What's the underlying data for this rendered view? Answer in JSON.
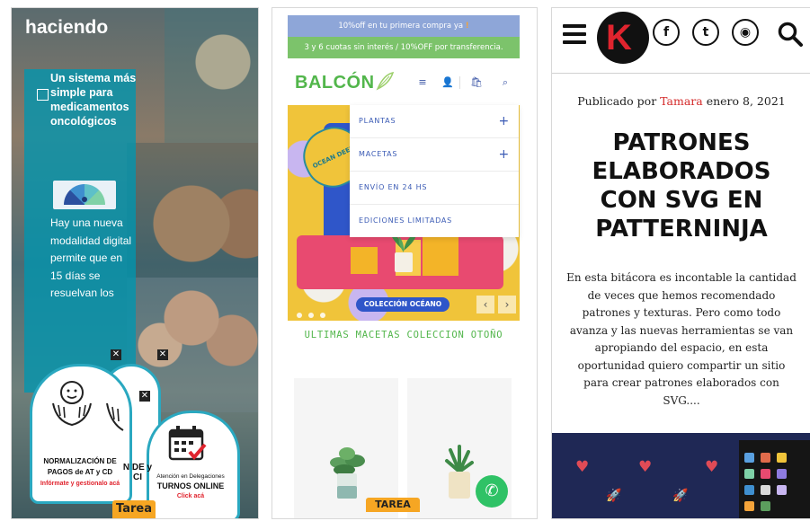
{
  "panel1": {
    "heading": "haciendo",
    "title": "Un sistema más simple para medicamentos oncológicos",
    "body": "Hay una nueva modalidad digital permite que en 15 días se resuelvan los",
    "badge_a_line1": "NORMALIZACIÓN DE",
    "badge_a_line2": "PAGOS de AT y CD",
    "badge_a_link": "Infórmate y gestionalo acá",
    "badge_b_text": "N DE y CI",
    "badge_c_line1": "Atención en Delegaciones",
    "badge_c_line2": "TURNOS ONLINE",
    "badge_c_link": "Click acá",
    "close": "✕",
    "tarea": "Tarea",
    "colors": {
      "overlay": "#0096af",
      "badge_border": "#2aa8c0",
      "tarea": "#f6a623"
    }
  },
  "panel2": {
    "promo1": "10%off en tu primera compra ya",
    "promo1_mark": "!",
    "promo2": "3 y 6 cuotas sin interés / 10%OFF por transferencia.",
    "brand": "BALCÓN",
    "icons": {
      "menu": "≡",
      "user": "👤",
      "cart": "🛍",
      "search": "⌕"
    },
    "menu": [
      {
        "label": "PLANTAS",
        "plus": "+"
      },
      {
        "label": "MACETAS",
        "plus": "+"
      },
      {
        "label": "ENVÍO EN 24 HS",
        "plus": ""
      },
      {
        "label": "EDICIONES LIMITADAS",
        "plus": ""
      }
    ],
    "stamp": "OCEAN DEEP",
    "hero_pill": "COLECCIÓN OCÉANO",
    "arrow_prev": "‹",
    "arrow_next": "›",
    "subtitle": "ULTIMAS MACETAS COLECCION OTOÑO",
    "whatsapp": "✆",
    "tarea": "TAREA",
    "colors": {
      "brand": "#52b64b",
      "promo1": "#8ea6d8",
      "promo2": "#7cc36b",
      "menu_text": "#3b5bb5"
    }
  },
  "panel3": {
    "social": {
      "facebook": "f",
      "twitter": "t",
      "rss": "◉"
    },
    "logo_letter": "K",
    "meta_prefix": "Publicado por",
    "author": "Tamara",
    "date": "enero 8, 2021",
    "title": "PATRONES ELABORADOS CON SVG EN PATTERNINJA",
    "excerpt": "En esta bitácora es incontable la cantidad de veces que hemos recomendado patrones y texturas. Pero como todo avanza y las nuevas herramientas se van apropiando del espacio, en esta oportunidad quiero compartir un sitio para crear patrones elaborados con SVG....",
    "pattern_heart": "♥",
    "pattern_rocket": "🚀",
    "colors": {
      "author": "#d42a2a",
      "logo": "#e0242e",
      "pattern_bg": "#1f2855"
    }
  }
}
